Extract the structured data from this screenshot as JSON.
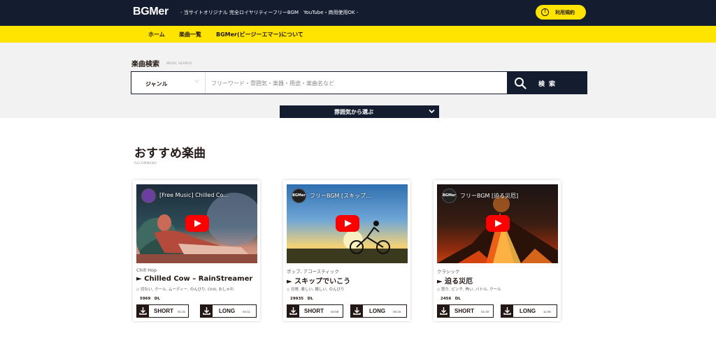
{
  "header": {
    "logo": "BGMer",
    "tagline": "- 当サイトオリジナル 完全ロイヤリティーフリーBGM　YouTube・商用使用OK -",
    "terms_label": "利用規約",
    "colors": {
      "navy": "#141d30",
      "yellow": "#ffe400"
    }
  },
  "nav": {
    "items": [
      {
        "label": "ホーム"
      },
      {
        "label": "楽曲一覧"
      },
      {
        "label": "BGMer(ビージーエマー)について"
      }
    ]
  },
  "search": {
    "title": "楽曲検索",
    "subtitle": "MUSIC SEARCH",
    "genre_label": "ジャンル",
    "placeholder": "フリーワード・雰囲気・楽器・用途・楽曲名など",
    "button_label": "検索",
    "mood_button": "雰囲気から選ぶ"
  },
  "recommend": {
    "title": "おすすめ楽曲",
    "subtitle": "RECOMMEND",
    "cards": [
      {
        "video_title": "[Free Music] Chilled Co...",
        "channel": "",
        "category": "Chill Hop",
        "title": "► Chilled Cow – RainStreamer",
        "tags": "切ない, クール, ムーディー, のんびり, Chill, おしゃれ",
        "downloads": "5969　DL",
        "short_label": "SHORT",
        "short_time": "01:31",
        "long_label": "LONG",
        "long_time": "04:11"
      },
      {
        "video_title": "フリーBGM [スキップ...",
        "channel": "BGMer",
        "category": "ポップ, アコースティック",
        "title": "► スキップでいこう",
        "tags": "日常, 楽しい, 嬉しい, のんびり",
        "downloads": "29935　DL",
        "short_label": "SHORT",
        "short_time": "02:59",
        "long_label": "LONG",
        "long_time": "05:16"
      },
      {
        "video_title": "フリーBGM [迫る災厄]",
        "channel": "BGMer",
        "category": "クラシック",
        "title": "► 迫る災厄",
        "tags": "怒り, ピンチ, 怖い, バトル, クール",
        "downloads": "2456　DL",
        "short_label": "SHORT",
        "short_time": "01:40",
        "long_label": "LONG",
        "long_time": "11:06"
      }
    ]
  }
}
